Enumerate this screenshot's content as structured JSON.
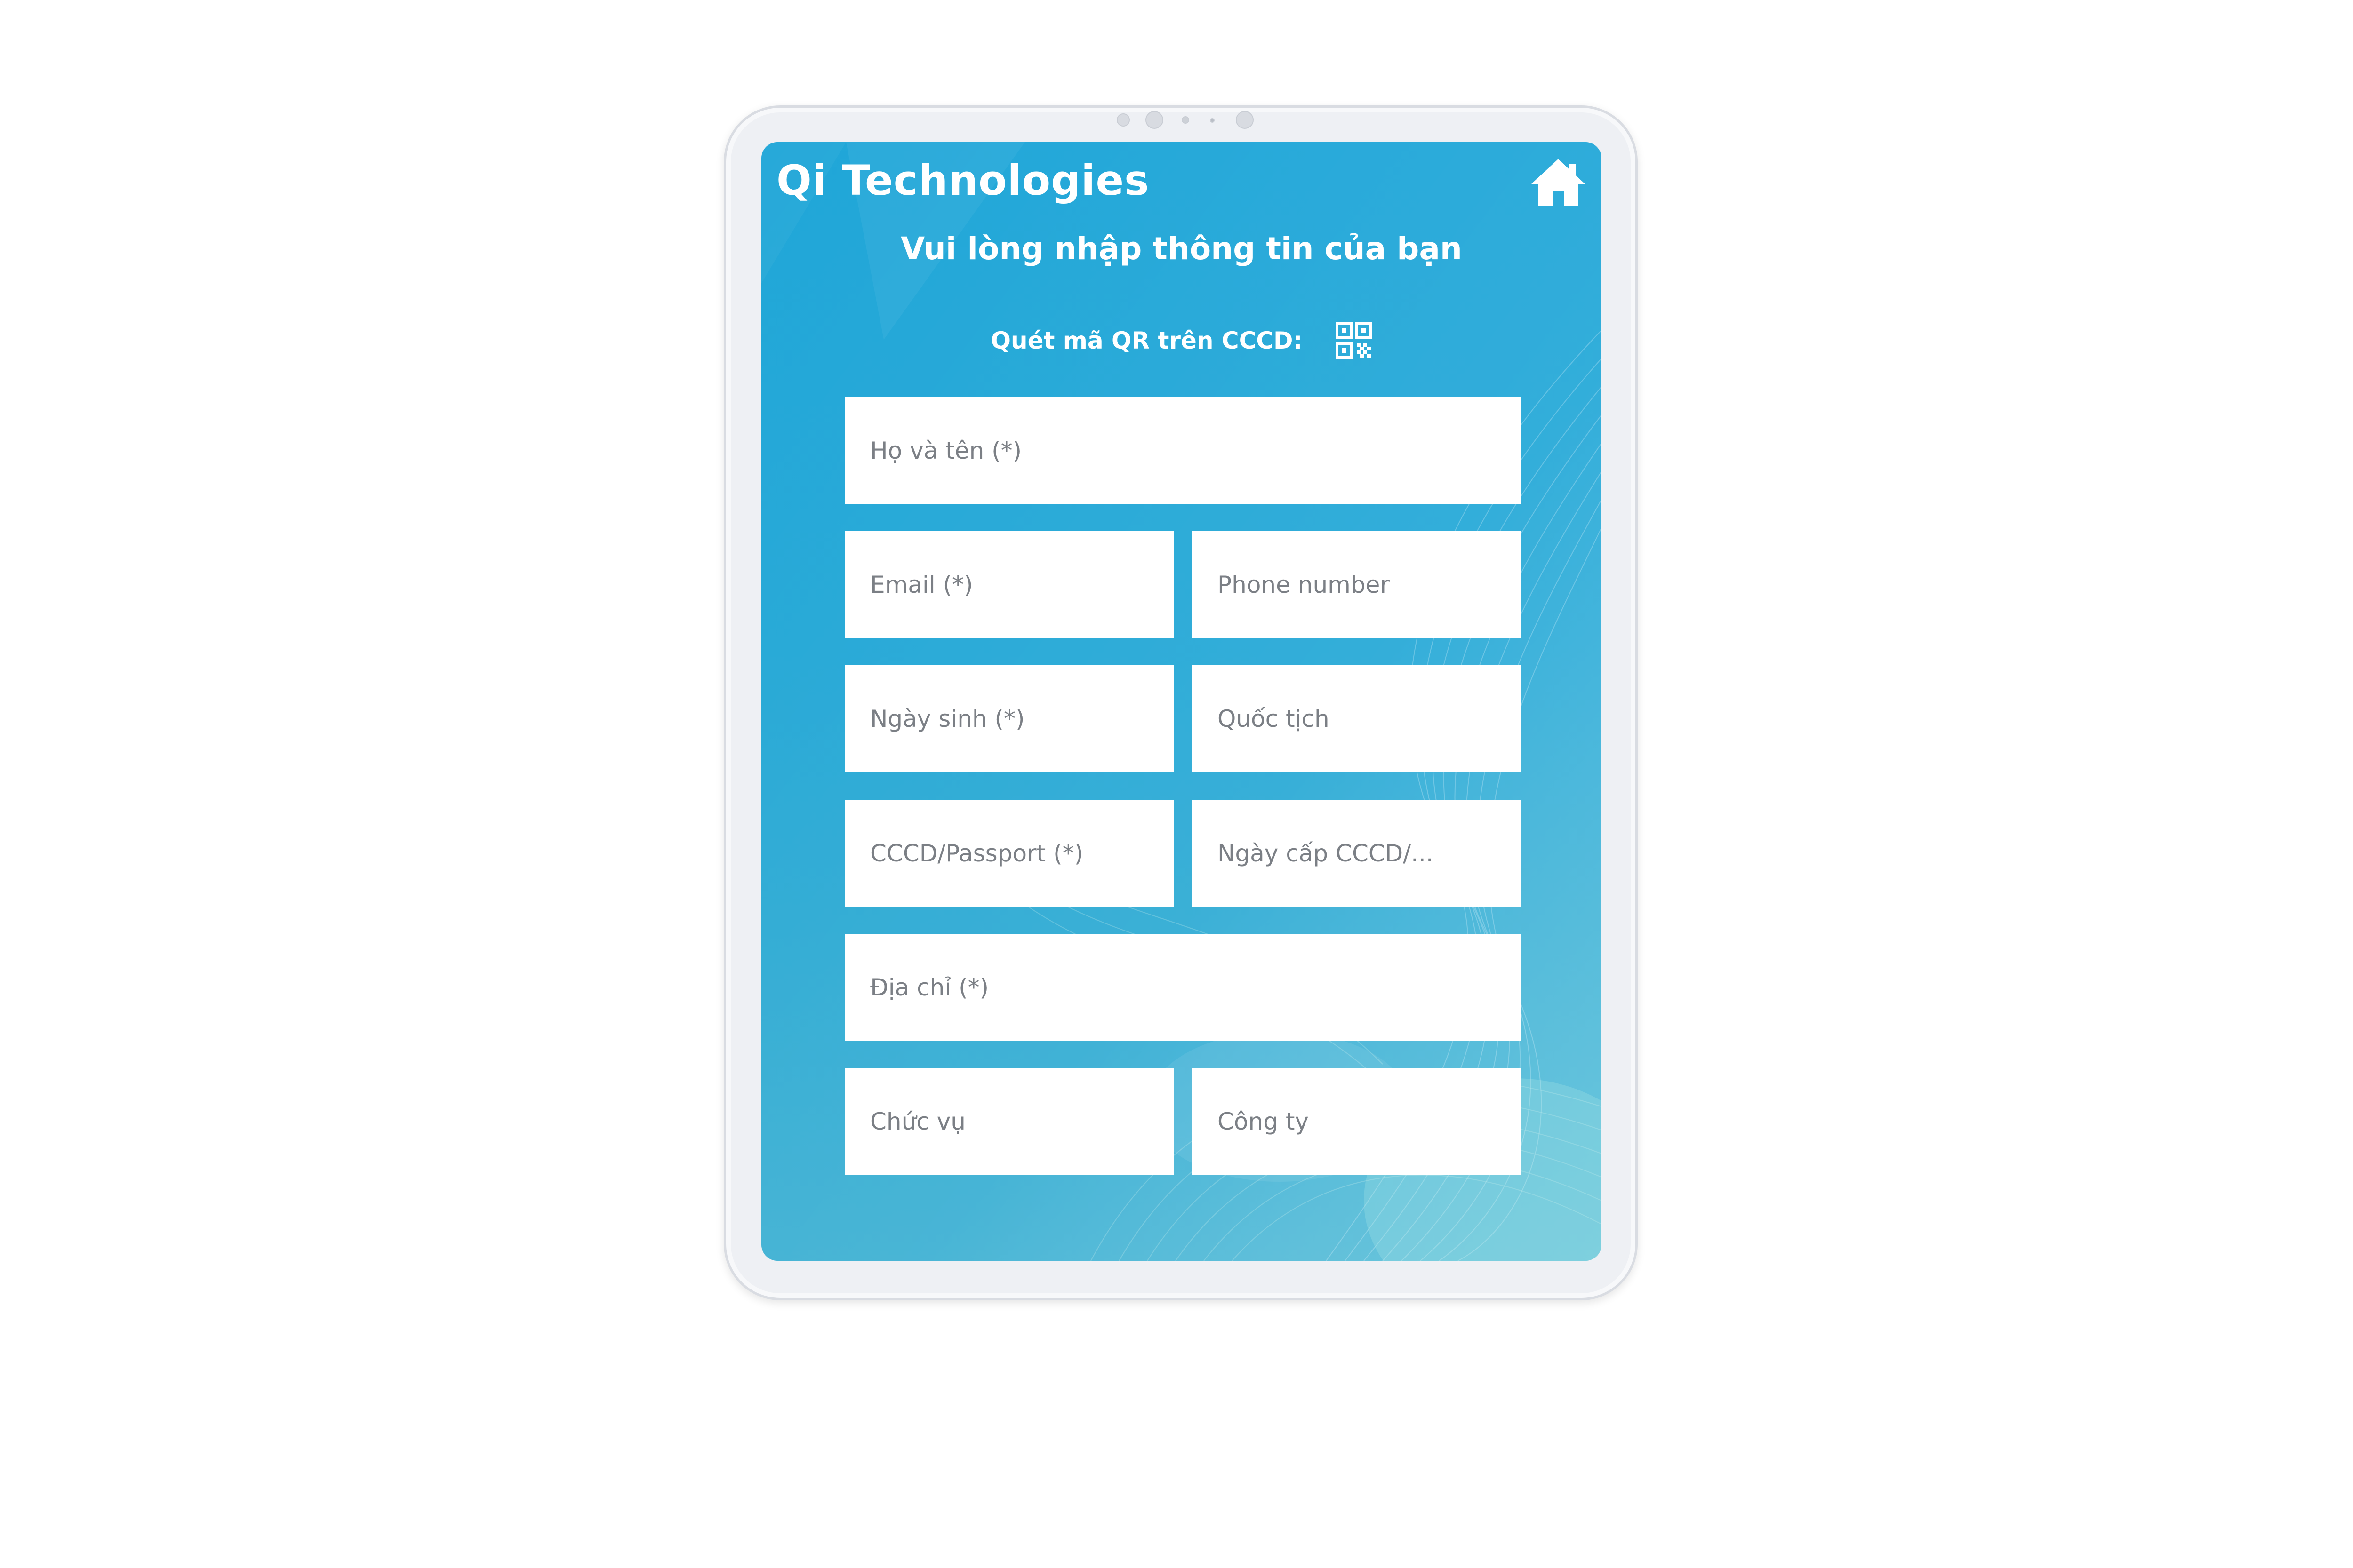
{
  "app": {
    "title": "Qi Technologies"
  },
  "icons": {
    "home": "home-icon",
    "qr": "qr-code-icon"
  },
  "colors": {
    "screen_background": "#22a7d6",
    "field_background": "#ffffff",
    "placeholder_text": "#7b7f85",
    "title_text": "#ffffff"
  },
  "form": {
    "heading": "Vui lòng nhập thông tin của bạn",
    "qr_label": "Quét mã QR trên CCCD:",
    "fields": {
      "full_name": "Họ và tên (*)",
      "email": "Email (*)",
      "phone": "Phone number",
      "dob": "Ngày sinh (*)",
      "nationality": "Quốc tịch",
      "id_number": "CCCD/Passport (*)",
      "id_issue_date": "Ngày cấp CCCD/...",
      "address": "Địa chỉ (*)",
      "position": "Chức vụ",
      "company": "Công ty"
    }
  }
}
